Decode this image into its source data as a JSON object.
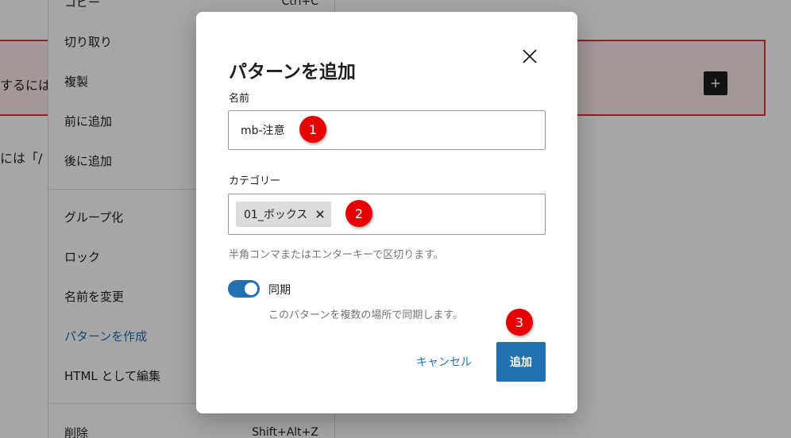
{
  "background": {
    "block_text_1": "するには",
    "block_text_2": "には「/",
    "plus_icon": "plus-icon"
  },
  "context_menu": {
    "items": [
      {
        "label": "コピー",
        "shortcut": "Ctrl+C"
      },
      {
        "label": "切り取り",
        "shortcut": ""
      },
      {
        "label": "複製",
        "shortcut": ""
      },
      {
        "label": "前に追加",
        "shortcut": ""
      },
      {
        "label": "後に追加",
        "shortcut": ""
      },
      {
        "label": "グループ化",
        "shortcut": ""
      },
      {
        "label": "ロック",
        "shortcut": ""
      },
      {
        "label": "名前を変更",
        "shortcut": ""
      },
      {
        "label": "パターンを作成",
        "shortcut": ""
      },
      {
        "label": "HTML として編集",
        "shortcut": ""
      },
      {
        "label": "削除",
        "shortcut": "Shift+Alt+Z"
      }
    ]
  },
  "modal": {
    "title": "パターンを追加",
    "close_icon": "close-icon",
    "name_label": "名前",
    "name_value": "mb-注意",
    "category_label": "カテゴリー",
    "category_token": "01_ボックス",
    "category_help": "半角コンマまたはエンターキーで区切ります。",
    "sync_label": "同期",
    "sync_enabled": true,
    "sync_help": "このパターンを複数の場所で同期します。",
    "cancel_label": "キャンセル",
    "add_label": "追加"
  },
  "badges": [
    "1",
    "2",
    "3"
  ],
  "colors": {
    "accent": "#2271b1",
    "badge": "#e60000",
    "block_border": "#d63638"
  }
}
